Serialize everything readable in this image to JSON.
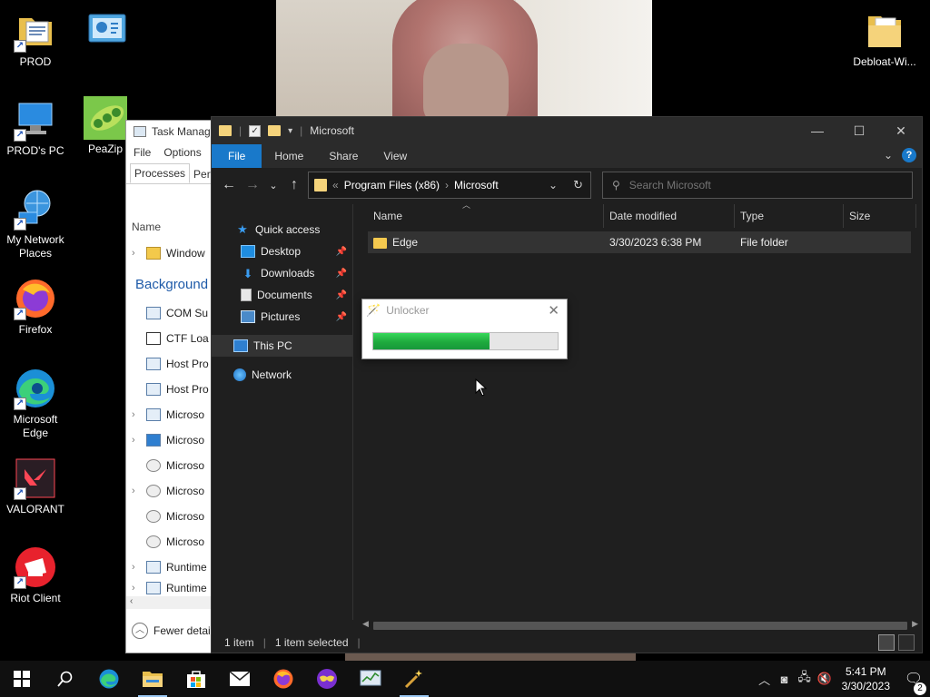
{
  "desktop_icons": [
    {
      "label": "PROD"
    },
    {
      "label": "PROD's PC"
    },
    {
      "label": "PeaZip"
    },
    {
      "label": "My Network Places"
    },
    {
      "label": "Firefox"
    },
    {
      "label": "Microsoft Edge"
    },
    {
      "label": "VALORANT"
    },
    {
      "label": "Riot Client"
    },
    {
      "label": "Debloat-Wi..."
    }
  ],
  "task_manager": {
    "title": "Task Manag",
    "menu": [
      "File",
      "Options"
    ],
    "tabs": [
      "Processes",
      "Perfo"
    ],
    "column_name": "Name",
    "app_row": "Window",
    "group_label": "Background",
    "rows": [
      "COM Su",
      "CTF Loa",
      "Host Pro",
      "Host Pro",
      "Microso",
      "Microso",
      "Microso",
      "Microso",
      "Microso",
      "Microso",
      "Runtime",
      "Runtime"
    ],
    "footer": "Fewer detai"
  },
  "explorer": {
    "title": "Microsoft",
    "ribbon_tabs": [
      "File",
      "Home",
      "Share",
      "View"
    ],
    "breadcrumb": [
      "Program Files (x86)",
      "Microsoft"
    ],
    "search_placeholder": "Search Microsoft",
    "nav": {
      "quick_access": "Quick access",
      "desktop": "Desktop",
      "downloads": "Downloads",
      "documents": "Documents",
      "pictures": "Pictures",
      "this_pc": "This PC",
      "network": "Network"
    },
    "columns": {
      "name": "Name",
      "date": "Date modified",
      "type": "Type",
      "size": "Size"
    },
    "files": [
      {
        "name": "Edge",
        "date": "3/30/2023 6:38 PM",
        "type": "File folder",
        "size": ""
      }
    ],
    "status": {
      "count": "1 item",
      "selected": "1 item selected"
    }
  },
  "unlocker": {
    "title": "Unlocker",
    "progress": 0.63
  },
  "taskbar": {
    "time": "5:41 PM",
    "date": "3/30/2023",
    "notification_count": "2"
  }
}
